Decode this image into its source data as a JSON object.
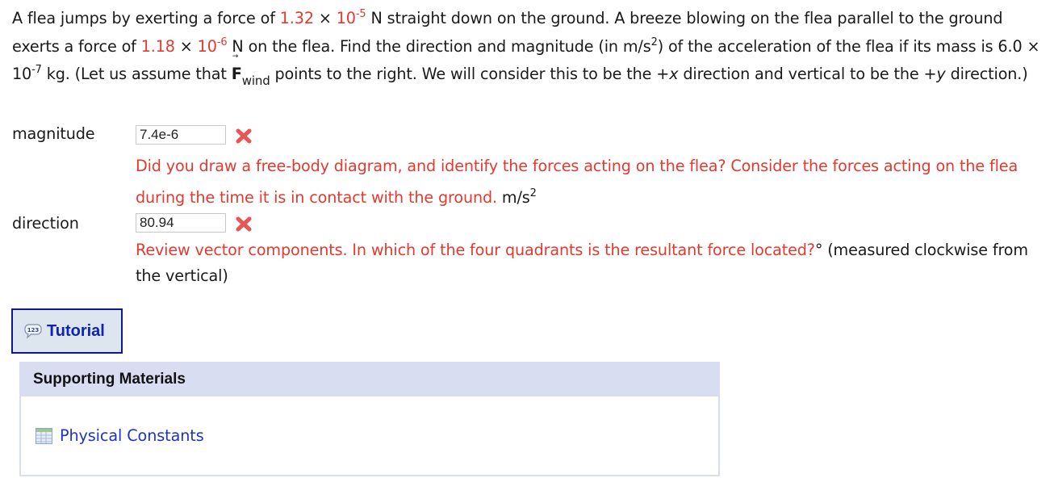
{
  "problem": {
    "t1": "A flea jumps by exerting a force of ",
    "f1_mantissa": "1.32",
    "times": " × ",
    "f1_base": "10",
    "f1_exp": "-5",
    "t2": " N straight down on the ground. A breeze blowing on the flea parallel to the ground exerts a force of ",
    "f2_mantissa": "1.18",
    "f2_base": "10",
    "f2_exp": "-6",
    "t3": " N on the flea. Find the direction and magnitude (in m/s",
    "sq": "2",
    "t4": ") of the acceleration of the flea if its mass is 6.0 × 10",
    "mass_exp": "-7",
    "t5": " kg. (Let us assume that ",
    "vec_symbol": "F",
    "vec_arrow": "→",
    "vec_sub": "wind",
    "t6": " points to the right. We will consider this to be the ",
    "plus_x": "+x",
    "t7": " direction and vertical to be the ",
    "plus_y": "+y",
    "t8": " direction.)"
  },
  "answers": [
    {
      "label": "magnitude",
      "value": "7.4e-6",
      "status": "incorrect",
      "feedback": "Did you draw a free-body diagram, and identify the forces acting on the flea? Consider the forces acting on the flea during the time it is in contact with the ground.",
      "unit": "m/s",
      "unit_exp": "2"
    },
    {
      "label": "direction",
      "value": "80.94",
      "status": "incorrect",
      "feedback": "Review vector components. In which of the four quadrants is the resultant force located?",
      "unit": "° (measured clockwise from the vertical)"
    }
  ],
  "tutorial": {
    "label": "Tutorial",
    "icon": "speech-bubble-123-icon"
  },
  "supporting_materials": {
    "title": "Supporting Materials",
    "items": [
      {
        "label": "Physical Constants",
        "icon": "table-icon"
      }
    ]
  },
  "colors": {
    "highlight_red": "#e23a2f",
    "link_blue": "#1f34c4",
    "tutorial_border": "#0b1a86",
    "panel_header": "#d8ddf2"
  }
}
